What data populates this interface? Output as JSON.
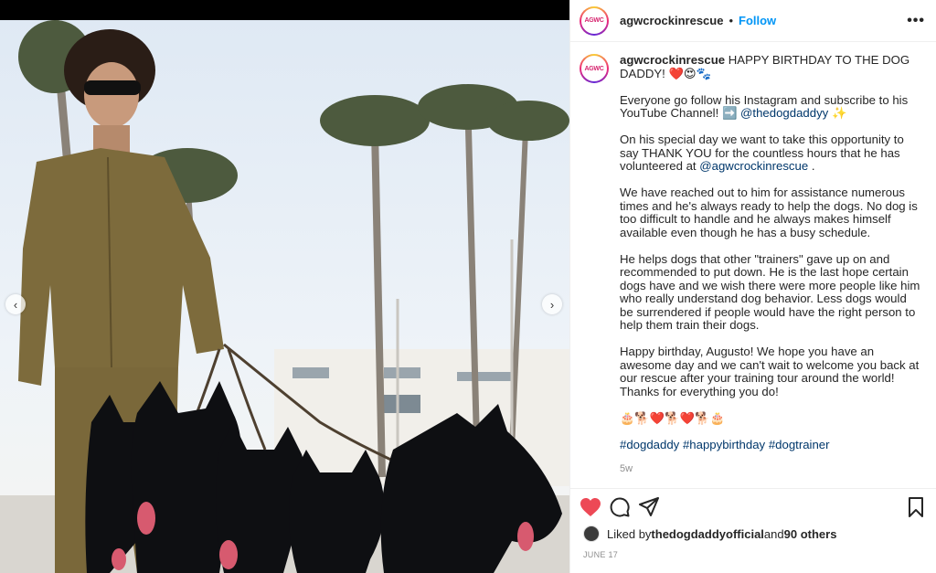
{
  "post": {
    "username": "agwcrockinrescue",
    "follow_label": "Follow",
    "separator": "•",
    "more_label": "•••",
    "avatar_text": "AGWC"
  },
  "caption": {
    "username": "agwcrockinrescue",
    "line1": "HAPPY BIRTHDAY TO THE DOG DADDY! ❤️😍🐾",
    "p2_text": "Everyone go follow his Instagram and subscribe to his YouTube Channel! ➡️ ",
    "p2_mention": "@thedogdaddyy",
    "p2_emoji": " ✨",
    "p3_text": "On his special day we want to take this opportunity to say THANK YOU for the countless hours that he has volunteered at ",
    "p3_mention": "@agwcrockinrescue",
    "p3_end": " .",
    "p4": "We have reached out to him for assistance numerous times and he's always ready to help the dogs. No dog is too difficult to handle and he always makes himself available even though he has a busy schedule.",
    "p5": "He helps dogs that other \"trainers\" gave up on and recommended to put down. He is the last hope certain dogs have and we wish there were more people like him who really understand dog behavior. Less dogs would be surrendered if people would have the right person to help them train their dogs.",
    "p6": "Happy birthday, Augusto! We hope you have an awesome day and we can't wait to welcome you back at our rescue after your training tour around the world! Thanks for everything you do!",
    "p7": "🎂🐕❤️🐕❤️🐕🎂",
    "hashtags": [
      "#dogdaddy",
      "#happybirthday",
      "#dogtrainer"
    ],
    "time": "5w"
  },
  "likes": {
    "prefix": "Liked by ",
    "user": "thedogdaddyofficial",
    "mid": " and ",
    "others": "90 others"
  },
  "date": "JUNE 17",
  "colors": {
    "like_red": "#ed4956",
    "link_blue": "#00376b",
    "follow_blue": "#0095f6"
  },
  "icons": [
    "chevron-left-icon",
    "chevron-right-icon",
    "heart-icon",
    "comment-icon",
    "share-icon",
    "bookmark-icon",
    "more-icon"
  ]
}
